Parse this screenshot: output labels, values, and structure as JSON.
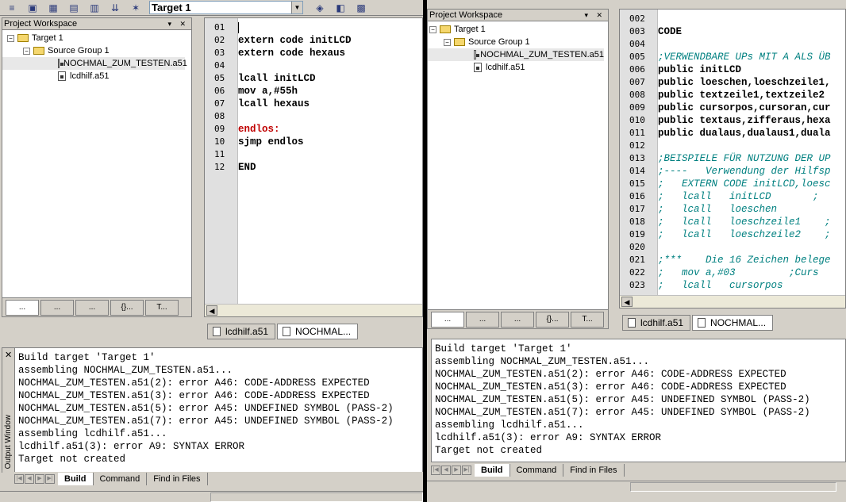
{
  "left": {
    "toolbar": {
      "target_value": "Target 1"
    },
    "workspace": {
      "title": "Project Workspace",
      "tree": {
        "target": "Target 1",
        "group": "Source Group 1",
        "files": [
          "NOCHMAL_ZUM_TESTEN.a51",
          "lcdhilf.a51"
        ]
      },
      "tabs": [
        "...",
        "...",
        "...",
        "{}...",
        "T..."
      ]
    },
    "editor": {
      "lines": [
        {
          "num": "01",
          "text": ""
        },
        {
          "num": "02",
          "text": "extern code initLCD"
        },
        {
          "num": "03",
          "text": "extern code hexaus"
        },
        {
          "num": "04",
          "text": ""
        },
        {
          "num": "05",
          "text": "lcall initLCD"
        },
        {
          "num": "06",
          "text": "mov a,#55h"
        },
        {
          "num": "07",
          "text": "lcall hexaus"
        },
        {
          "num": "08",
          "text": ""
        },
        {
          "num": "09",
          "text": "endlos:"
        },
        {
          "num": "10",
          "text": "sjmp endlos"
        },
        {
          "num": "11",
          "text": ""
        },
        {
          "num": "12",
          "text": "END"
        }
      ],
      "file_tabs": [
        "lcdhilf.a51",
        "NOCHMAL..."
      ]
    },
    "output": {
      "panel_label": "Output Window",
      "lines": [
        "Build target 'Target 1'",
        "assembling NOCHMAL_ZUM_TESTEN.a51...",
        "NOCHMAL_ZUM_TESTEN.a51(2): error A46: CODE-ADDRESS EXPECTED",
        "NOCHMAL_ZUM_TESTEN.a51(3): error A46: CODE-ADDRESS EXPECTED",
        "NOCHMAL_ZUM_TESTEN.a51(5): error A45: UNDEFINED SYMBOL (PASS-2)",
        "NOCHMAL_ZUM_TESTEN.a51(7): error A45: UNDEFINED SYMBOL (PASS-2)",
        "assembling lcdhilf.a51...",
        "lcdhilf.a51(3): error A9: SYNTAX ERROR",
        "Target not created"
      ],
      "tabs": [
        "Build",
        "Command",
        "Find in Files"
      ]
    }
  },
  "right": {
    "workspace": {
      "title": "Project Workspace",
      "tree": {
        "target": "Target 1",
        "group": "Source Group 1",
        "files": [
          "NOCHMAL_ZUM_TESTEN.a51",
          "lcdhilf.a51"
        ]
      },
      "tabs": [
        "...",
        "...",
        "...",
        "{}...",
        "T..."
      ]
    },
    "editor": {
      "lines": [
        {
          "num": "002",
          "text": ""
        },
        {
          "num": "003",
          "text": "CODE"
        },
        {
          "num": "004",
          "text": ""
        },
        {
          "num": "005",
          "text": ";VERWENDBARE UPs MIT A ALS ÜB"
        },
        {
          "num": "006",
          "text": "public initLCD"
        },
        {
          "num": "007",
          "text": "public loeschen,loeschzeile1,"
        },
        {
          "num": "008",
          "text": "public textzeile1,textzeile2"
        },
        {
          "num": "009",
          "text": "public cursorpos,cursoran,cur"
        },
        {
          "num": "010",
          "text": "public textaus,zifferaus,hexa"
        },
        {
          "num": "011",
          "text": "public dualaus,dualaus1,duala"
        },
        {
          "num": "012",
          "text": ""
        },
        {
          "num": "013",
          "text": ";BEISPIELE FÜR NUTZUNG DER UP"
        },
        {
          "num": "014",
          "text": ";----   Verwendung der Hilfsp"
        },
        {
          "num": "015",
          "text": ";   EXTERN CODE initLCD,loesc"
        },
        {
          "num": "016",
          "text": ";   lcall   initLCD       ;"
        },
        {
          "num": "017",
          "text": ";   lcall   loeschen"
        },
        {
          "num": "018",
          "text": ";   lcall   loeschzeile1    ;"
        },
        {
          "num": "019",
          "text": ";   lcall   loeschzeile2    ;"
        },
        {
          "num": "020",
          "text": ""
        },
        {
          "num": "021",
          "text": ";***    Die 16 Zeichen belege"
        },
        {
          "num": "022",
          "text": ";   mov a,#03         ;Curs"
        },
        {
          "num": "023",
          "text": ";   lcall   cursorpos"
        }
      ],
      "file_tabs": [
        "lcdhilf.a51",
        "NOCHMAL..."
      ]
    },
    "output": {
      "lines": [
        "Build target 'Target 1'",
        "assembling NOCHMAL_ZUM_TESTEN.a51...",
        "NOCHMAL_ZUM_TESTEN.a51(2): error A46: CODE-ADDRESS EXPECTED",
        "NOCHMAL_ZUM_TESTEN.a51(3): error A46: CODE-ADDRESS EXPECTED",
        "NOCHMAL_ZUM_TESTEN.a51(5): error A45: UNDEFINED SYMBOL (PASS-2)",
        "NOCHMAL_ZUM_TESTEN.a51(7): error A45: UNDEFINED SYMBOL (PASS-2)",
        "assembling lcdhilf.a51...",
        "lcdhilf.a51(3): error A9: SYNTAX ERROR",
        "Target not created"
      ],
      "tabs": [
        "Build",
        "Command",
        "Find in Files"
      ]
    }
  }
}
